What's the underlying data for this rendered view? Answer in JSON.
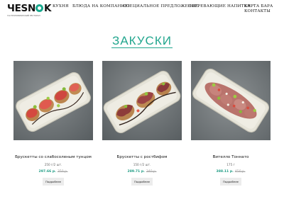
{
  "brand": {
    "wordmark": "ЧESNOK",
    "tagline": "ГАСТРОНОМИЧЕСКИЙ РЕСТОРАН"
  },
  "nav": [
    {
      "label": "КУХНЯ"
    },
    {
      "label": "БЛЮДА НА КОМПАНИЮ"
    },
    {
      "label": "СПЕЦИАЛЬНОЕ ПРЕДЛОЖЕНИЕ"
    },
    {
      "label": "СОГРЕВАЮЩИЕ НАПИТКИ"
    },
    {
      "label_line1": "КАРТА БАРА",
      "label_line2": "КОНТАКТЫ"
    }
  ],
  "section": {
    "title": "ЗАКУСКИ"
  },
  "products": [
    {
      "name": "Брускетты со слабосоленым тунцом",
      "weight": "250 г/2 шт.",
      "price": "297.66 р.",
      "old_price": "350 р.",
      "button": "Подробнее"
    },
    {
      "name": "Брускетты с ростбифом",
      "weight": "150 г/2 шт.",
      "price": "289.71 р.",
      "old_price": "340 р.",
      "button": "Подробнее"
    },
    {
      "name": "Вителло Тоннато",
      "weight": "175 г",
      "price": "388.11 р.",
      "old_price": "450 р.",
      "button": "Подробнее"
    }
  ],
  "colors": {
    "accent": "#22a68e",
    "price": "#1f9c84"
  }
}
